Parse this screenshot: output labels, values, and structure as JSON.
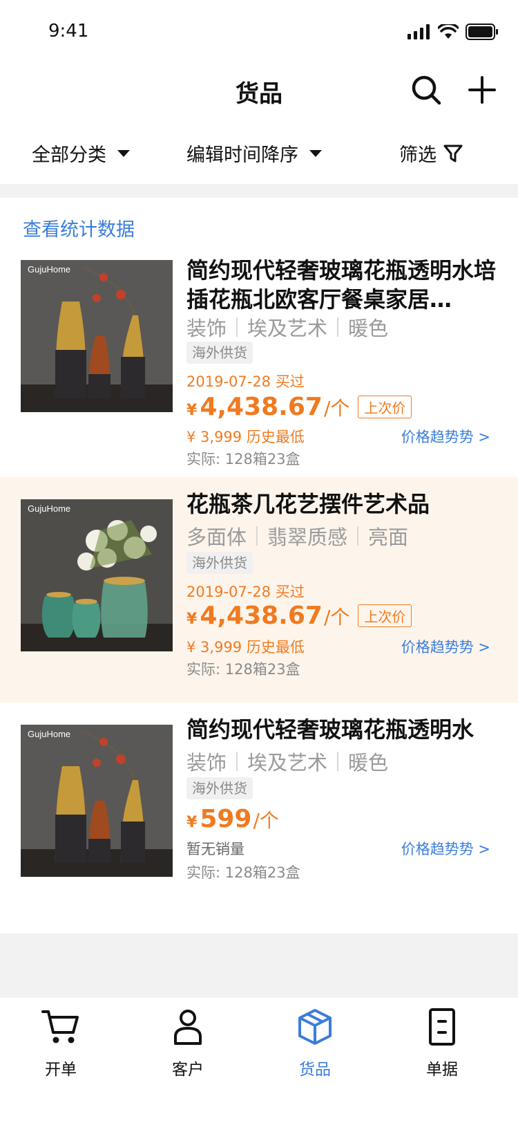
{
  "status_bar": {
    "time": "9:41"
  },
  "nav": {
    "title": "货品"
  },
  "filters": [
    {
      "label": "全部分类"
    },
    {
      "label": "编辑时间降序"
    },
    {
      "label": "筛选"
    }
  ],
  "stats_link": "查看统计数据",
  "products": [
    {
      "title": "简约现代轻奢玻璃花瓶透明水培插花瓶北欧客厅餐桌家居…",
      "tags": [
        "装饰",
        "埃及艺术",
        "暖色"
      ],
      "badge": "海外供货",
      "bought": "2019-07-28 买过",
      "currency": "¥",
      "price": "4,438.67",
      "unit": "/个",
      "last_price_label": "上次价",
      "history_low": "¥ 3,999 历史最低",
      "trend": "价格趋势势 >",
      "actual": "实际: 128箱23盒",
      "image_brand": "GujuHome"
    },
    {
      "title": "花瓶茶几花艺摆件艺术品",
      "tags": [
        "多面体",
        "翡翠质感",
        "亮面"
      ],
      "badge": "海外供货",
      "bought": "2019-07-28 买过",
      "currency": "¥",
      "price": "4,438.67",
      "unit": "/个",
      "last_price_label": "上次价",
      "history_low": "¥ 3,999 历史最低",
      "trend": "价格趋势势 >",
      "actual": "实际: 128箱23盒",
      "image_brand": "GujuHome"
    },
    {
      "title": "简约现代轻奢玻璃花瓶透明水",
      "tags": [
        "装饰",
        "埃及艺术",
        "暖色"
      ],
      "badge": "海外供货",
      "currency": "¥",
      "price": "599",
      "unit": "/个",
      "no_sales": "暂无销量",
      "trend": "价格趋势势 >",
      "actual": "实际: 128箱23盒",
      "image_brand": "GujuHome"
    }
  ],
  "tabs": [
    {
      "label": "开单",
      "icon": "cart-icon",
      "active": false
    },
    {
      "label": "客户",
      "icon": "user-icon",
      "active": false
    },
    {
      "label": "货品",
      "icon": "box-icon",
      "active": true
    },
    {
      "label": "单据",
      "icon": "document-icon",
      "active": false
    }
  ],
  "colors": {
    "accent": "#3a7ddb",
    "price": "#f07a20",
    "highlight_bg": "#fdf5ec"
  }
}
